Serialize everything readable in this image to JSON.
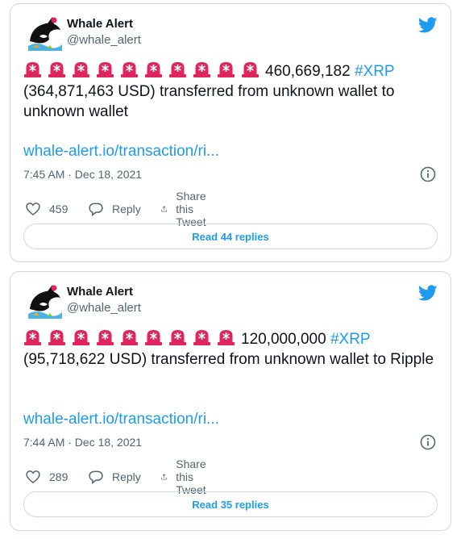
{
  "colors": {
    "accent": "#1d9bf0",
    "siren": "#e0245e",
    "text": "#0f1419",
    "muted": "#536471",
    "border": "#cfd9de"
  },
  "tweets": [
    {
      "name": "Whale Alert",
      "handle": "@whale_alert",
      "icons": {
        "avatar": "orca-avatar",
        "brand": "twitter-bird-icon",
        "siren": "rotating-light-icon",
        "info": "info-icon"
      },
      "siren_count": 10,
      "amount": "460,669,182",
      "hashtag": "#XRP",
      "body_rest": "(364,871,463 USD) transferred from unknown wallet to unknown wallet",
      "link": "whale-alert.io/transaction/ri...",
      "time": "7:45 AM · Dec 18, 2021",
      "likes": "459",
      "reply_label": "Reply",
      "share_label": "Share this Tweet",
      "read_replies": "Read 44 replies"
    },
    {
      "name": "Whale Alert",
      "handle": "@whale_alert",
      "icons": {
        "avatar": "orca-avatar",
        "brand": "twitter-bird-icon",
        "siren": "rotating-light-icon",
        "info": "info-icon"
      },
      "siren_count": 9,
      "amount": "120,000,000",
      "hashtag": "#XRP",
      "body_rest": "(95,718,622 USD) transferred from unknown wallet to Ripple",
      "link": "whale-alert.io/transaction/ri...",
      "time": "7:44 AM · Dec 18, 2021",
      "likes": "289",
      "reply_label": "Reply",
      "share_label": "Share this Tweet",
      "read_replies": "Read 35 replies"
    }
  ]
}
